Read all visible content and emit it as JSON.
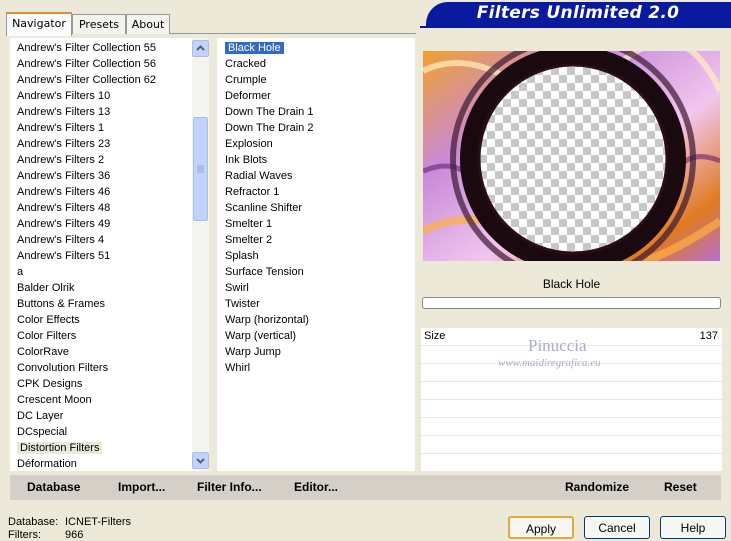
{
  "tabs": [
    "Navigator",
    "Presets",
    "About"
  ],
  "banner": {
    "title": "Filters Unlimited 2.0"
  },
  "categories": [
    "Andrew's Filter Collection 55",
    "Andrew's Filter Collection 56",
    "Andrew's Filter Collection 62",
    "Andrew's Filters 10",
    "Andrew's Filters 13",
    "Andrew's Filters 1",
    "Andrew's Filters 23",
    "Andrew's Filters 2",
    "Andrew's Filters 36",
    "Andrew's Filters 46",
    "Andrew's Filters 48",
    "Andrew's Filters 49",
    "Andrew's Filters 4",
    "Andrew's Filters 51",
    "a",
    "Balder Olrik",
    "Buttons & Frames",
    "Color Effects",
    "Color Filters",
    "ColorRave",
    "Convolution Filters",
    "CPK Designs",
    "Crescent Moon",
    "DC Layer",
    "DCspecial",
    "Distortion Filters",
    "Déformation"
  ],
  "selected_category": "Distortion Filters",
  "filters": [
    "Black Hole",
    "Cracked",
    "Crumple",
    "Deformer",
    "Down The Drain 1",
    "Down The Drain 2",
    "Explosion",
    "Ink Blots",
    "Radial Waves",
    "Refractor 1",
    "Scanline Shifter",
    "Smelter 1",
    "Smelter 2",
    "Splash",
    "Surface Tension",
    "Swirl",
    "Twister",
    "Warp (horizontal)",
    "Warp (vertical)",
    "Warp Jump",
    "Whirl"
  ],
  "selected_filter": "Black Hole",
  "preview": {
    "filter_name": "Black Hole",
    "progress": 0
  },
  "params": {
    "name": "Size",
    "value": "137"
  },
  "watermark": {
    "name": "Pinuccia",
    "url": "www.maidiregrafica.eu"
  },
  "bottom_buttons": {
    "database": "Database",
    "import": "Import...",
    "filter_info": "Filter Info...",
    "editor": "Editor...",
    "randomize": "Randomize",
    "reset": "Reset"
  },
  "status": {
    "database_label": "Database:",
    "database_value": "ICNET-Filters",
    "filters_label": "Filters:",
    "filters_value": "966"
  },
  "dialog_buttons": {
    "apply": "Apply",
    "cancel": "Cancel",
    "help": "Help"
  },
  "colors": {
    "banner": "#0a1a9e",
    "selection": "#316ac5",
    "tab_accent": "#e68b2c"
  }
}
